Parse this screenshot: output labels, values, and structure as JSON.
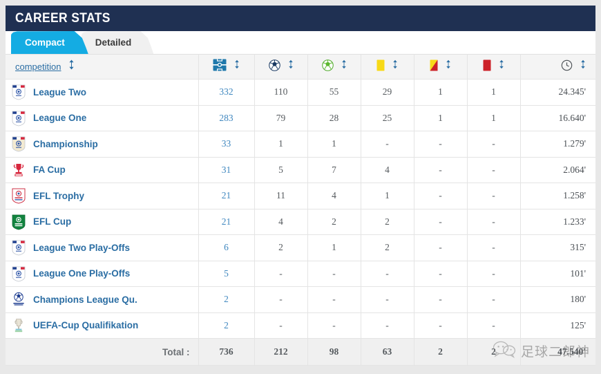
{
  "header": {
    "title": "CAREER STATS",
    "bar_color": "#1f3052"
  },
  "tabs": [
    {
      "label": "Compact",
      "active": true,
      "color": "#14ace3"
    },
    {
      "label": "Detailed",
      "active": false,
      "color": "#f0f0f0"
    }
  ],
  "table": {
    "columns": [
      {
        "key": "competition",
        "label": "competition",
        "icon": "sort-updown-icon",
        "type": "link-header"
      },
      {
        "key": "appearances",
        "label": "",
        "icon": "pitch-icon",
        "type": "icon-header"
      },
      {
        "key": "goals",
        "label": "",
        "icon": "soccer-ball-dark-icon",
        "type": "icon-header"
      },
      {
        "key": "assists",
        "label": "",
        "icon": "soccer-ball-green-icon",
        "type": "icon-header"
      },
      {
        "key": "yellow_cards",
        "label": "",
        "icon": "yellow-card-icon",
        "type": "icon-header"
      },
      {
        "key": "second_yellow_cards",
        "label": "",
        "icon": "second-yellow-card-icon",
        "type": "icon-header"
      },
      {
        "key": "red_cards",
        "label": "",
        "icon": "red-card-icon",
        "type": "icon-header"
      },
      {
        "key": "minutes",
        "label": "",
        "icon": "clock-icon",
        "type": "icon-header"
      }
    ],
    "rows": [
      {
        "badge": "efl-league-two-badge",
        "competition": "League Two",
        "appearances": "332",
        "goals": "110",
        "assists": "55",
        "yellow_cards": "29",
        "second_yellow_cards": "1",
        "red_cards": "1",
        "minutes": "24.345'"
      },
      {
        "badge": "efl-league-one-badge",
        "competition": "League One",
        "appearances": "283",
        "goals": "79",
        "assists": "28",
        "yellow_cards": "25",
        "second_yellow_cards": "1",
        "red_cards": "1",
        "minutes": "16.640'"
      },
      {
        "badge": "efl-championship-badge",
        "competition": "Championship",
        "appearances": "33",
        "goals": "1",
        "assists": "1",
        "yellow_cards": "-",
        "second_yellow_cards": "-",
        "red_cards": "-",
        "minutes": "1.279'"
      },
      {
        "badge": "fa-cup-badge",
        "competition": "FA Cup",
        "appearances": "31",
        "goals": "5",
        "assists": "7",
        "yellow_cards": "4",
        "second_yellow_cards": "-",
        "red_cards": "-",
        "minutes": "2.064'"
      },
      {
        "badge": "efl-trophy-badge",
        "competition": "EFL Trophy",
        "appearances": "21",
        "goals": "11",
        "assists": "4",
        "yellow_cards": "1",
        "second_yellow_cards": "-",
        "red_cards": "-",
        "minutes": "1.258'"
      },
      {
        "badge": "efl-cup-badge",
        "competition": "EFL Cup",
        "appearances": "21",
        "goals": "4",
        "assists": "2",
        "yellow_cards": "2",
        "second_yellow_cards": "-",
        "red_cards": "-",
        "minutes": "1.233'"
      },
      {
        "badge": "efl-league-two-badge",
        "competition": "League Two Play-Offs",
        "appearances": "6",
        "goals": "2",
        "assists": "1",
        "yellow_cards": "2",
        "second_yellow_cards": "-",
        "red_cards": "-",
        "minutes": "315'"
      },
      {
        "badge": "efl-league-one-badge",
        "competition": "League One Play-Offs",
        "appearances": "5",
        "goals": "-",
        "assists": "-",
        "yellow_cards": "-",
        "second_yellow_cards": "-",
        "red_cards": "-",
        "minutes": "101'"
      },
      {
        "badge": "champions-league-badge",
        "competition": "Champions League Qu.",
        "appearances": "2",
        "goals": "-",
        "assists": "-",
        "yellow_cards": "-",
        "second_yellow_cards": "-",
        "red_cards": "-",
        "minutes": "180'"
      },
      {
        "badge": "uefa-cup-badge",
        "competition": "UEFA-Cup Qualifikation",
        "appearances": "2",
        "goals": "-",
        "assists": "-",
        "yellow_cards": "-",
        "second_yellow_cards": "-",
        "red_cards": "-",
        "minutes": "125'"
      }
    ],
    "total": {
      "label": "Total :",
      "appearances": "736",
      "goals": "212",
      "assists": "98",
      "yellow_cards": "63",
      "second_yellow_cards": "2",
      "red_cards": "2",
      "minutes": "47.540'"
    }
  },
  "watermark": {
    "text": "足球二郎神",
    "icon": "wechat-bubble-icon"
  },
  "colors": {
    "link": "#2a6da3",
    "accent_cyan": "#14ace3",
    "header_navy": "#1f3052",
    "yellow_card": "#f7d917",
    "red_card": "#cc2128",
    "appearance_number": "#3f87bf"
  }
}
